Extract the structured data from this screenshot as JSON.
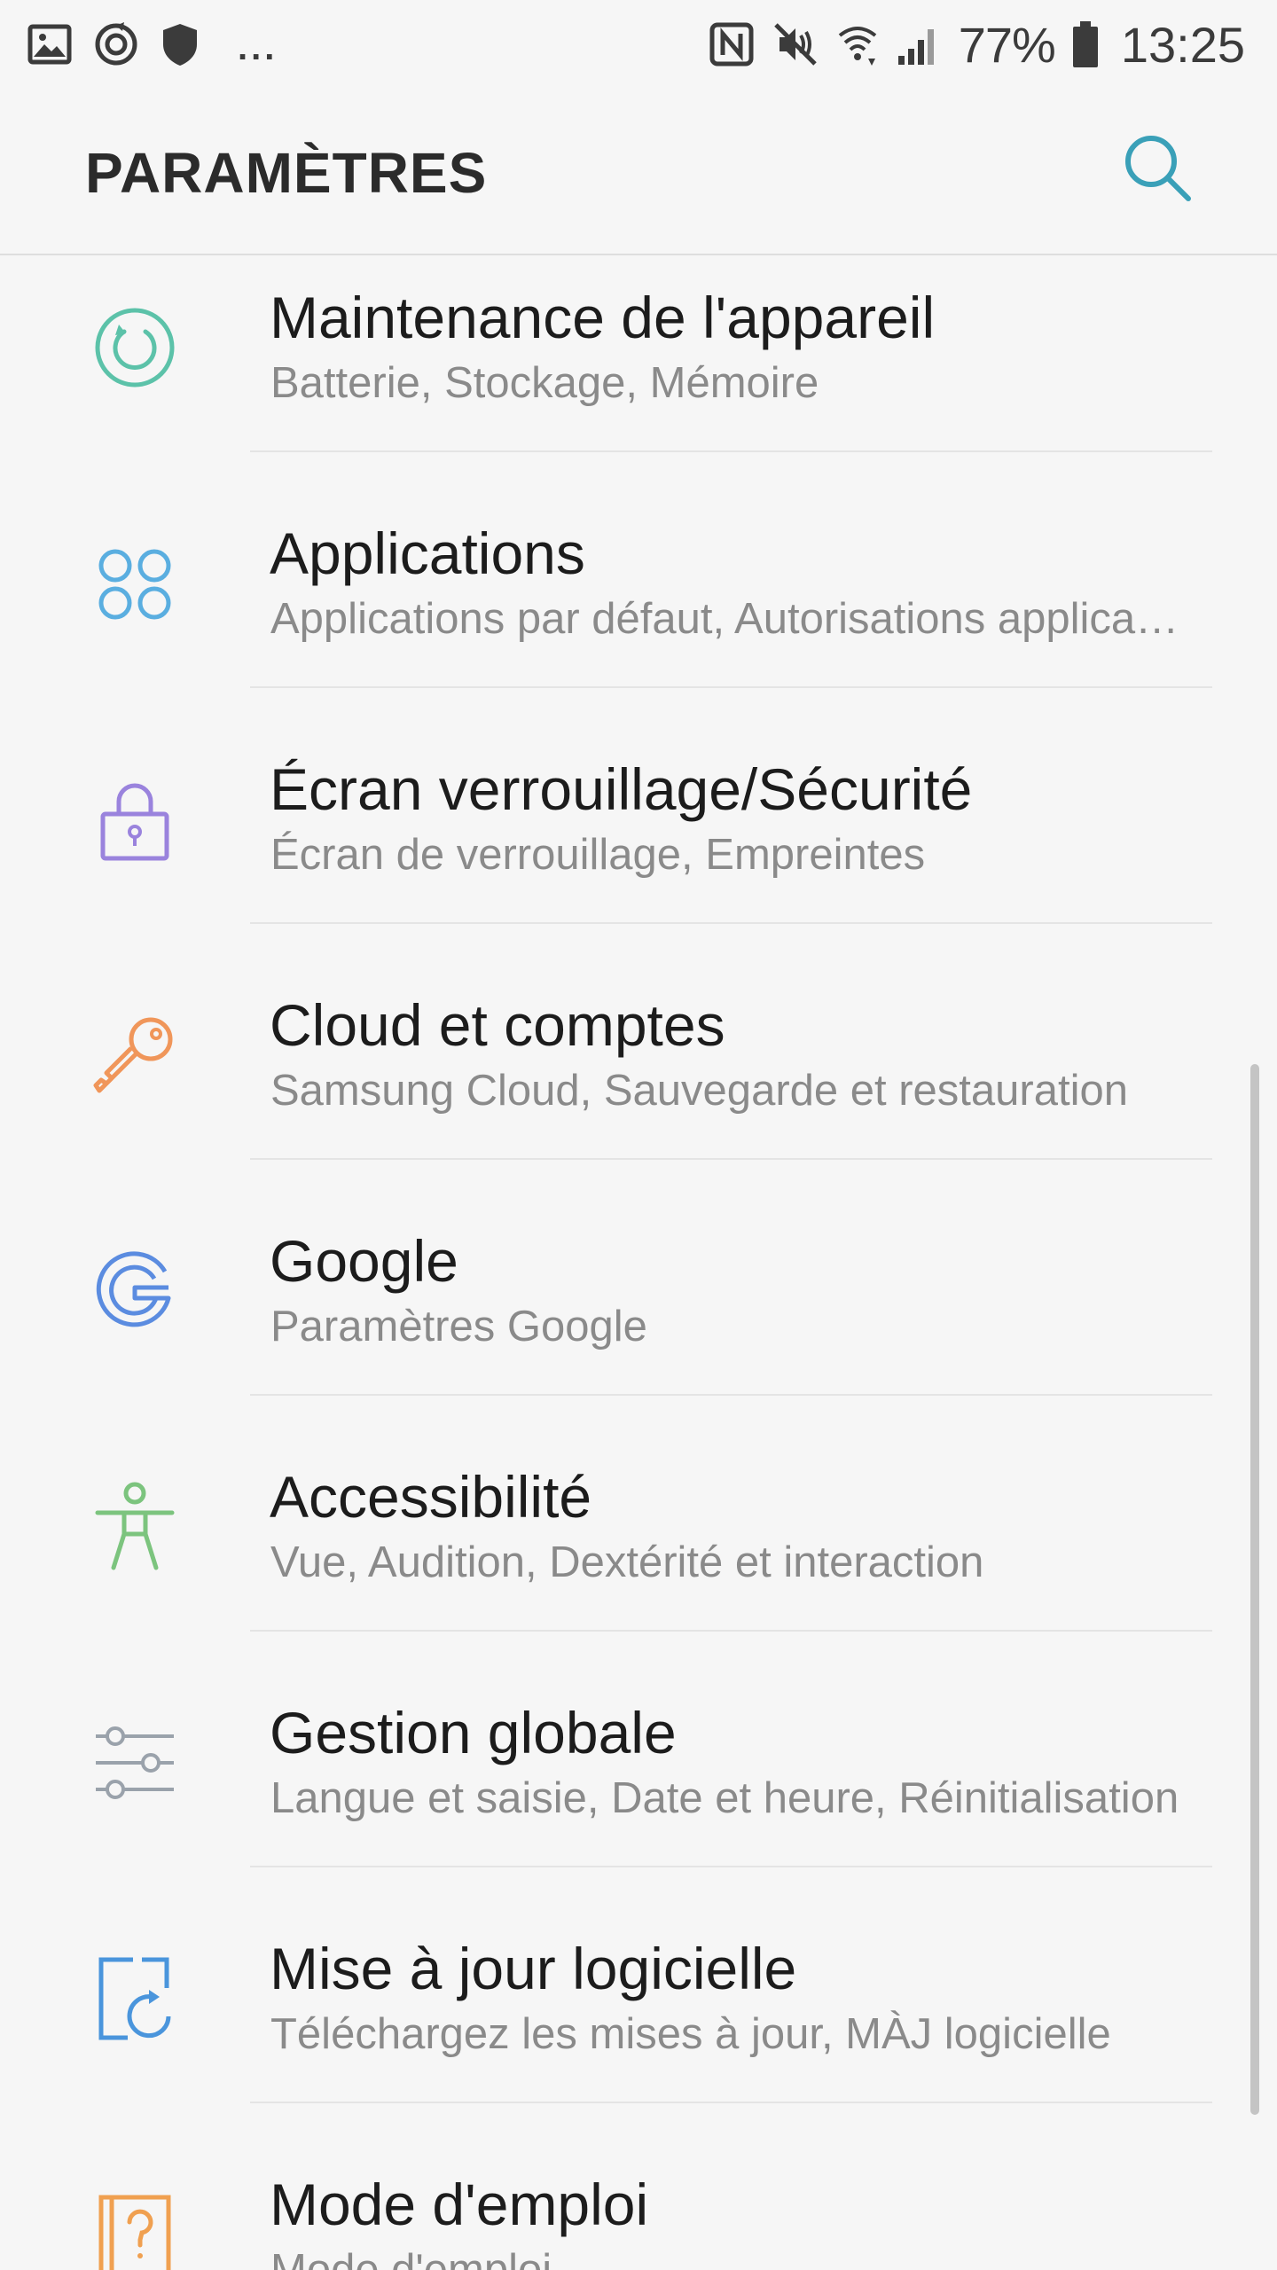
{
  "status_bar": {
    "left_icons": [
      "gallery-icon",
      "sync-icon",
      "shield-icon"
    ],
    "overflow": "...",
    "right_icons": [
      "nfc-icon",
      "mute-icon",
      "wifi-icon",
      "signal-icon",
      "battery-icon"
    ],
    "battery": "77%",
    "time": "13:25"
  },
  "app_bar": {
    "title": "PARAMÈTRES",
    "search_icon": "search-icon"
  },
  "settings": [
    {
      "title": "Maintenance de l'appareil",
      "subtitle": "Batterie, Stockage, Mémoire",
      "icon": "device-maintenance-icon",
      "color": "#5cc2a9"
    },
    {
      "title": "Applications",
      "subtitle": "Applications par défaut, Autorisations applications",
      "icon": "apps-icon",
      "color": "#5aaee0"
    },
    {
      "title": "Écran verrouillage/Sécurité",
      "subtitle": "Écran de verrouillage, Empreintes",
      "icon": "lock-icon",
      "color": "#9a83dd"
    },
    {
      "title": "Cloud et comptes",
      "subtitle": "Samsung Cloud, Sauvegarde et restauration",
      "icon": "key-icon",
      "color": "#f0965a"
    },
    {
      "title": "Google",
      "subtitle": "Paramètres Google",
      "icon": "google-icon",
      "color": "#5b8ce0"
    },
    {
      "title": "Accessibilité",
      "subtitle": "Vue, Audition, Dextérité et interaction",
      "icon": "accessibility-icon",
      "color": "#7cc47e"
    },
    {
      "title": "Gestion globale",
      "subtitle": "Langue et saisie, Date et heure, Réinitialisation",
      "icon": "sliders-icon",
      "color": "#9aa2ab"
    },
    {
      "title": "Mise à jour logicielle",
      "subtitle": "Téléchargez les mises à jour, MÀJ logicielle",
      "icon": "software-update-icon",
      "color": "#4a95dc"
    },
    {
      "title": "Mode d'emploi",
      "subtitle": "Mode d'emploi",
      "icon": "user-manual-icon",
      "color": "#f0a050"
    }
  ]
}
